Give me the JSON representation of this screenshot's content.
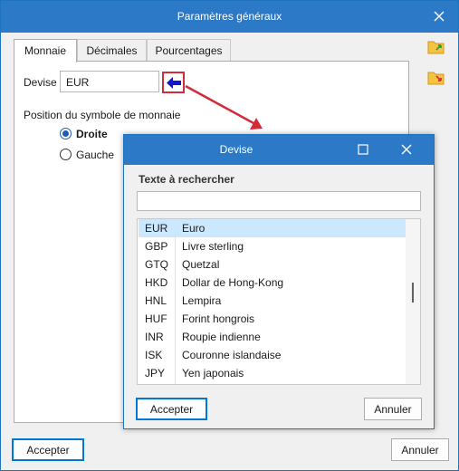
{
  "window": {
    "title": "Paramètres généraux",
    "titlebar_color": "#2b79c7"
  },
  "tabs": [
    {
      "label": "Monnaie",
      "active": true
    },
    {
      "label": "Décimales",
      "active": false
    },
    {
      "label": "Pourcentages",
      "active": false
    }
  ],
  "currency": {
    "label": "Devise",
    "value": "EUR",
    "picker_icon": "blue-arrow-left-icon"
  },
  "position": {
    "label": "Position du symbole de monnaie",
    "options": [
      {
        "label": "Droite",
        "selected": true
      },
      {
        "label": "Gauche",
        "selected": false
      }
    ]
  },
  "side_toolbar": {
    "items": [
      "folder-import-icon",
      "folder-export-icon"
    ]
  },
  "main_buttons": {
    "accept": "Accepter",
    "cancel": "Annuler"
  },
  "dialog": {
    "title": "Devise",
    "search_label": "Texte à rechercher",
    "search_value": "",
    "rows": [
      {
        "code": "EUR",
        "name": "Euro",
        "selected": true
      },
      {
        "code": "GBP",
        "name": "Livre sterling",
        "selected": false
      },
      {
        "code": "GTQ",
        "name": "Quetzal",
        "selected": false
      },
      {
        "code": "HKD",
        "name": "Dollar de Hong-Kong",
        "selected": false
      },
      {
        "code": "HNL",
        "name": "Lempira",
        "selected": false
      },
      {
        "code": "HUF",
        "name": "Forint hongrois",
        "selected": false
      },
      {
        "code": "INR",
        "name": "Roupie indienne",
        "selected": false
      },
      {
        "code": "ISK",
        "name": "Couronne islandaise",
        "selected": false
      },
      {
        "code": "JPY",
        "name": "Yen japonais",
        "selected": false
      }
    ],
    "accept": "Accepter",
    "cancel": "Annuler"
  },
  "colors": {
    "selection": "#cce8ff",
    "highlight_border": "#d42b3b",
    "arrow": "#d42b3b"
  }
}
